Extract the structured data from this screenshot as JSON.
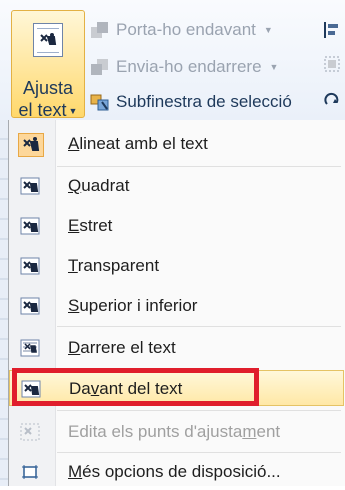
{
  "ribbon": {
    "wrap_button": {
      "line1": "Ajusta",
      "line2": "el text"
    },
    "bring_forward": {
      "label": "Porta-ho endavant"
    },
    "send_backward": {
      "label": "Envia-ho endarrere"
    },
    "selection_pane": {
      "label": "Subfinestra de selecció"
    }
  },
  "menu": {
    "items": [
      {
        "pre": "",
        "key": "A",
        "post": "lineat amb el text"
      },
      {
        "pre": "",
        "key": "Q",
        "post": "uadrat"
      },
      {
        "pre": "",
        "key": "E",
        "post": "stret"
      },
      {
        "pre": "",
        "key": "T",
        "post": "ransparent"
      },
      {
        "pre": "",
        "key": "S",
        "post": "uperior i inferior"
      },
      {
        "pre": "",
        "key": "D",
        "post": "arrere el text"
      },
      {
        "pre": "Da",
        "key": "v",
        "post": "ant del text"
      },
      {
        "pre": "Edita els punts d'ajusta",
        "key": "m",
        "post": "ent"
      },
      {
        "pre": "",
        "key": "M",
        "post": "és opcions de disposició..."
      }
    ]
  },
  "colors": {
    "accent_ribbon": "#ffd86b",
    "highlight_box": "#e01e2c",
    "menu_text": "#1e1e1e",
    "disabled_text": "#a0a0a0"
  }
}
